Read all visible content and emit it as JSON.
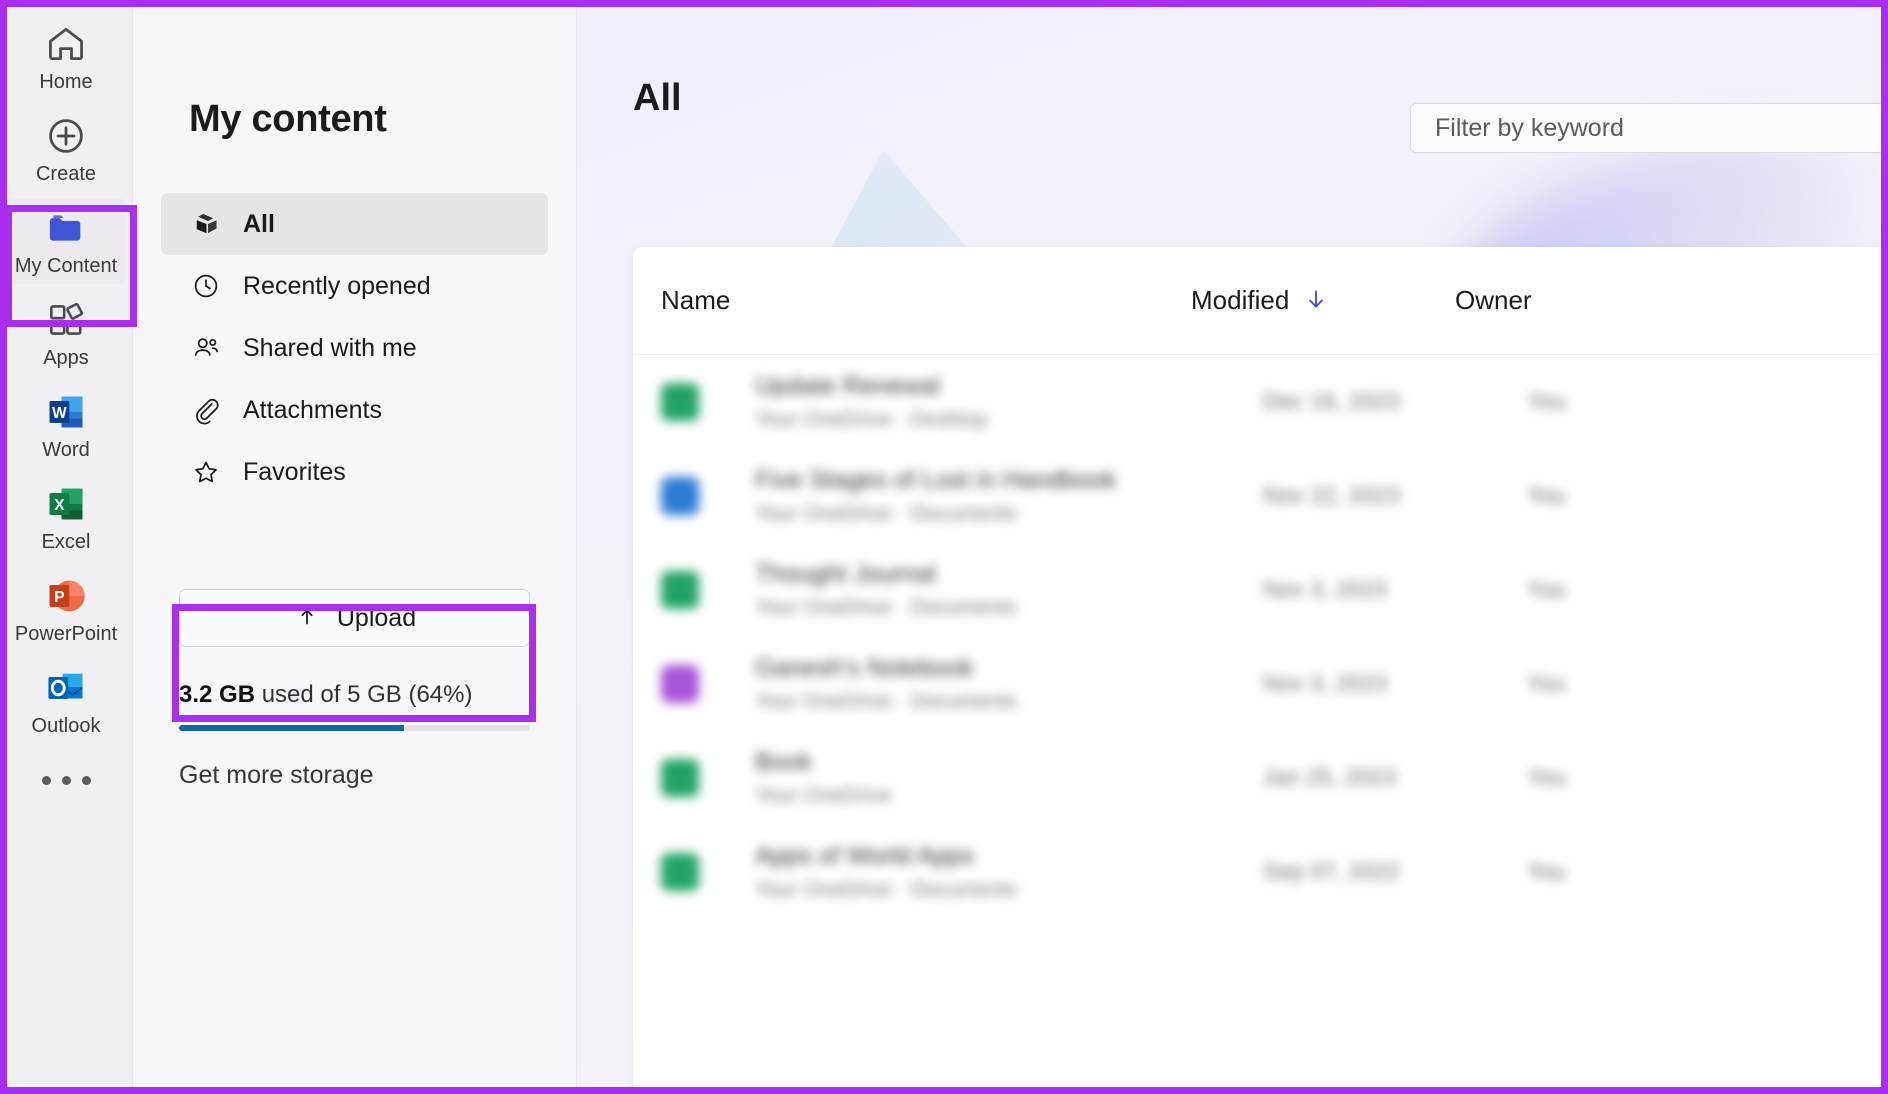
{
  "rail": {
    "items": [
      {
        "label": "Home",
        "icon": "home-icon",
        "active": false
      },
      {
        "label": "Create",
        "icon": "plus-circle-icon",
        "active": false
      },
      {
        "label": "My Content",
        "icon": "folder-icon",
        "active": true
      },
      {
        "label": "Apps",
        "icon": "apps-grid-icon",
        "active": false
      },
      {
        "label": "Word",
        "icon": "word-icon",
        "active": false
      },
      {
        "label": "Excel",
        "icon": "excel-icon",
        "active": false
      },
      {
        "label": "PowerPoint",
        "icon": "powerpoint-icon",
        "active": false
      },
      {
        "label": "Outlook",
        "icon": "outlook-icon",
        "active": false
      }
    ],
    "more_label": "more-options-icon"
  },
  "content_panel": {
    "title": "My content",
    "nav": [
      {
        "label": "All",
        "icon": "stack-icon",
        "active": true
      },
      {
        "label": "Recently opened",
        "icon": "clock-icon",
        "active": false
      },
      {
        "label": "Shared with me",
        "icon": "people-icon",
        "active": false
      },
      {
        "label": "Attachments",
        "icon": "paperclip-icon",
        "active": false
      },
      {
        "label": "Favorites",
        "icon": "star-icon",
        "active": false
      }
    ],
    "upload_label": "Upload",
    "storage": {
      "used": "3.2 GB",
      "rest": " used of 5 GB (64%)",
      "percent": 64,
      "bar_color": "#12689e",
      "link": "Get more storage"
    }
  },
  "main": {
    "title": "All",
    "filter_placeholder": "Filter by keyword",
    "filter_value": "",
    "table": {
      "columns": {
        "name": "Name",
        "modified": "Modified",
        "owner": "Owner"
      },
      "sort_icon": "arrow-down-icon",
      "sort_color": "#4a4ad8",
      "rows": [
        {
          "name": "Update Renewal",
          "sub": "Your OneDrive · Desktop",
          "modified": "Dec 16, 2023",
          "owner": "You",
          "icon_color": "#21a366"
        },
        {
          "name": "Five Stages of Lost in Handbook",
          "sub": "Your OneDrive · Documents",
          "modified": "Nov 22, 2023",
          "owner": "You",
          "icon_color": "#2b7cd3"
        },
        {
          "name": "Thought Journal",
          "sub": "Your OneDrive · Documents",
          "modified": "Nov 3, 2023",
          "owner": "You",
          "icon_color": "#21a366"
        },
        {
          "name": "Ganesh's Notebook",
          "sub": "Your OneDrive · Documents",
          "modified": "Nov 3, 2023",
          "owner": "You",
          "icon_color": "#a855d8"
        },
        {
          "name": "Book",
          "sub": "Your OneDrive",
          "modified": "Jan 25, 2023",
          "owner": "You",
          "icon_color": "#21a366"
        },
        {
          "name": "Apps of World Apps",
          "sub": "Your OneDrive · Documents",
          "modified": "Sep 07, 2022",
          "owner": "You",
          "icon_color": "#21a366"
        }
      ]
    }
  },
  "annotations": {
    "color": "#aa2ef0",
    "regions": [
      "page-border",
      "my-content-rail-item",
      "upload-button"
    ]
  }
}
